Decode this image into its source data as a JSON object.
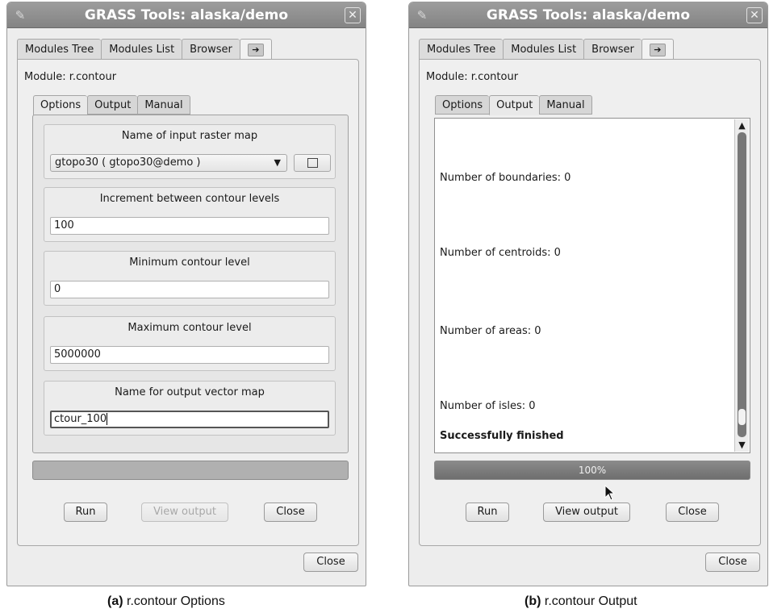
{
  "window_a": {
    "title": "GRASS Tools: alaska/demo",
    "tabs": [
      "Modules Tree",
      "Modules List",
      "Browser"
    ],
    "tab_arrow": "➔",
    "module_label": "Module: r.contour",
    "subtabs": [
      "Options",
      "Output",
      "Manual"
    ],
    "active_subtab": "Options",
    "groups": [
      {
        "label": "Name of input raster map",
        "value": "gtopo30 ( gtopo30@demo )"
      },
      {
        "label": "Increment between contour levels",
        "value": "100"
      },
      {
        "label": "Minimum contour level",
        "value": "0"
      },
      {
        "label": "Maximum contour level",
        "value": "5000000"
      },
      {
        "label": "Name for output vector map",
        "value": "ctour_100"
      }
    ],
    "progress_percent": 0,
    "buttons": {
      "run": "Run",
      "view_output": "View output",
      "close": "Close"
    },
    "close_window": "Close",
    "caption_letter": "(a)",
    "caption_text": " r.contour Options"
  },
  "window_b": {
    "title": "GRASS Tools: alaska/demo",
    "tabs": [
      "Modules Tree",
      "Modules List",
      "Browser"
    ],
    "tab_arrow": "➔",
    "module_label": "Module: r.contour",
    "subtabs": [
      "Options",
      "Output",
      "Manual"
    ],
    "active_subtab": "Output",
    "output_lines": [
      "Number of boundaries: 0",
      "Number of centroids: 0",
      "Number of areas: 0",
      "Number of isles: 0"
    ],
    "finished_line": "Successfully finished",
    "progress_percent": 100,
    "progress_label": "100%",
    "buttons": {
      "run": "Run",
      "view_output": "View output",
      "close": "Close"
    },
    "close_window": "Close",
    "caption_letter": "(b)",
    "caption_text": " r.contour Output"
  },
  "icons": {
    "wm_menu": "pen-icon",
    "close": "close-icon",
    "dropdown": "chevron-down-icon",
    "browse": "square-icon",
    "arrow": "arrow-right-icon"
  }
}
